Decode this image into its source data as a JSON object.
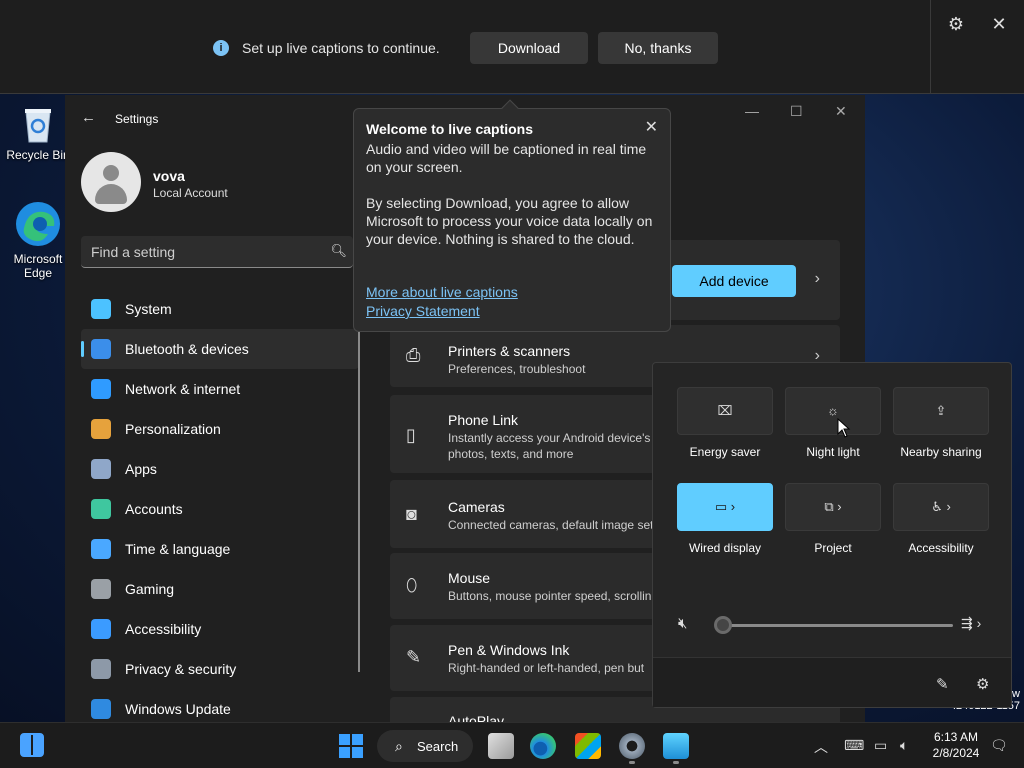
{
  "desktop": {
    "icons": [
      {
        "label": "Recycle Bin"
      },
      {
        "label": "Microsoft Edge"
      }
    ]
  },
  "caption_bar": {
    "info_glyph": "i",
    "message": "Set up live captions to continue.",
    "download": "Download",
    "no_thanks": "No, thanks"
  },
  "settings": {
    "title": "Settings",
    "user_name": "vova",
    "user_type": "Local Account",
    "search_placeholder": "Find a setting",
    "nav": [
      {
        "label": "System",
        "color": "#4cc2ff"
      },
      {
        "label": "Bluetooth & devices",
        "color": "#3b8eea"
      },
      {
        "label": "Network & internet",
        "color": "#2f9bff"
      },
      {
        "label": "Personalization",
        "color": "#e6a23c"
      },
      {
        "label": "Apps",
        "color": "#8fa7c9"
      },
      {
        "label": "Accounts",
        "color": "#3fc79f"
      },
      {
        "label": "Time & language",
        "color": "#4aa8ff"
      },
      {
        "label": "Gaming",
        "color": "#9aa0a6"
      },
      {
        "label": "Accessibility",
        "color": "#3b9bff"
      },
      {
        "label": "Privacy & security",
        "color": "#8d99a8"
      },
      {
        "label": "Windows Update",
        "color": "#2f8ae0"
      }
    ],
    "add_device": "Add device",
    "rows": [
      {
        "title": "Printers & scanners",
        "sub": "Preferences, troubleshoot"
      },
      {
        "title": "Phone Link",
        "sub": "Instantly access your Android device's photos, texts, and more"
      },
      {
        "title": "Cameras",
        "sub": "Connected cameras, default image set"
      },
      {
        "title": "Mouse",
        "sub": "Buttons, mouse pointer speed, scrollin"
      },
      {
        "title": "Pen & Windows Ink",
        "sub": "Right-handed or left-handed, pen but"
      },
      {
        "title": "AutoPlay",
        "sub": ""
      }
    ],
    "build_text": "w\n.240122-1157"
  },
  "popup": {
    "title": "Welcome to live captions",
    "para1": "Audio and video will be captioned in real time on your screen.",
    "para2": "By selecting Download, you agree to allow Microsoft to process your voice data locally on your device. Nothing is shared to the cloud.",
    "link1": "More about live captions",
    "link2": "Privacy Statement"
  },
  "quick_settings": {
    "tiles": [
      {
        "label": "Energy saver",
        "on": false
      },
      {
        "label": "Night light",
        "on": false
      },
      {
        "label": "Nearby sharing",
        "on": false
      },
      {
        "label": "Wired display",
        "on": true
      },
      {
        "label": "Project",
        "on": false
      },
      {
        "label": "Accessibility",
        "on": false
      }
    ],
    "volume": 0
  },
  "taskbar": {
    "search_label": "Search",
    "time": "6:13 AM",
    "date": "2/8/2024"
  }
}
